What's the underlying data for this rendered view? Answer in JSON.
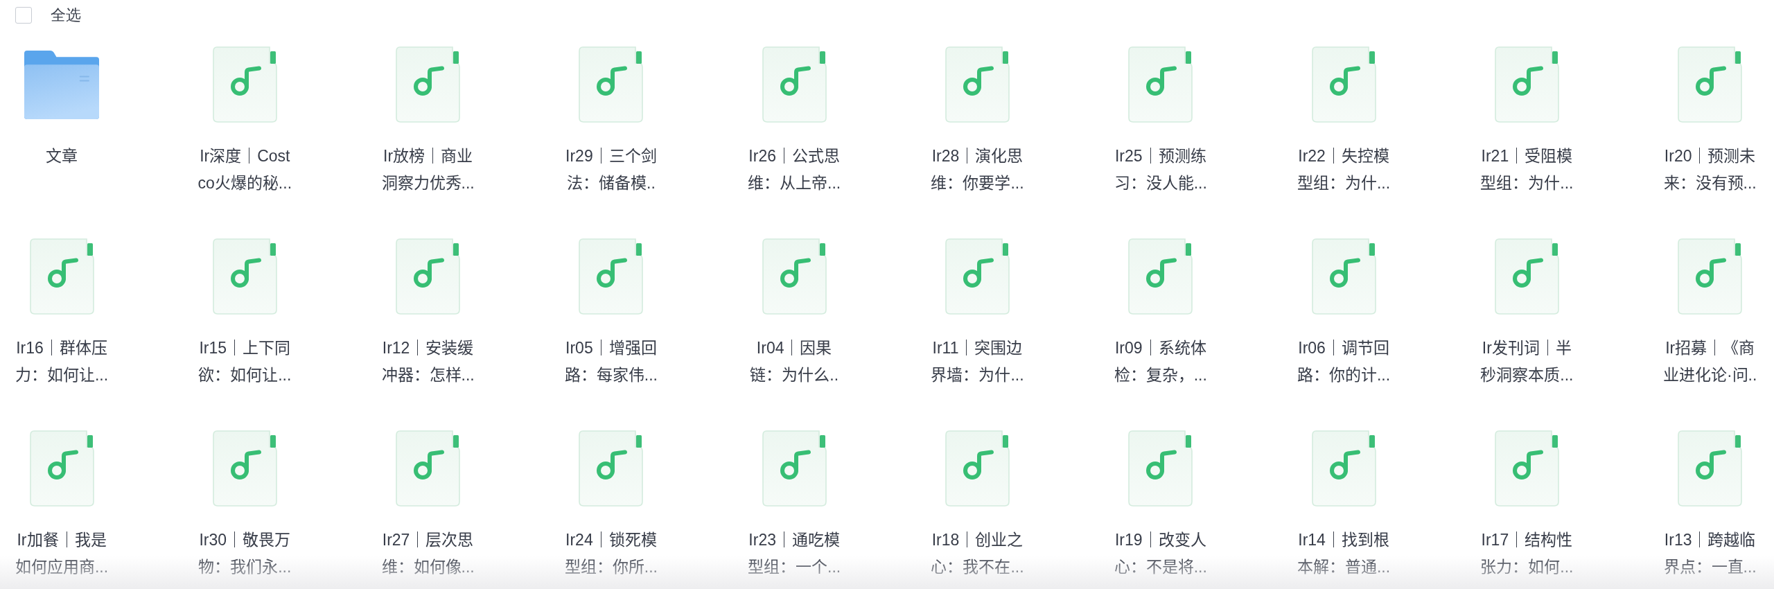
{
  "select_all": {
    "label": "全选",
    "checked": false
  },
  "items": [
    {
      "kind": "folder",
      "name": "文章"
    },
    {
      "kind": "audio",
      "name": "Ir深度｜Costco火爆的秘..."
    },
    {
      "kind": "audio",
      "name": "Ir放榜｜商业洞察力优秀..."
    },
    {
      "kind": "audio",
      "name": "Ir29｜三个剑法：储备模.."
    },
    {
      "kind": "audio",
      "name": "Ir26｜公式思维：从上帝..."
    },
    {
      "kind": "audio",
      "name": "Ir28｜演化思维：你要学..."
    },
    {
      "kind": "audio",
      "name": "Ir25｜预测练习：没人能..."
    },
    {
      "kind": "audio",
      "name": "Ir22｜失控模型组：为什..."
    },
    {
      "kind": "audio",
      "name": "Ir21｜受阻模型组：为什..."
    },
    {
      "kind": "audio",
      "name": "Ir20｜预测未来：没有预..."
    },
    {
      "kind": "audio",
      "name": "Ir16｜群体压力：如何让..."
    },
    {
      "kind": "audio",
      "name": "Ir15｜上下同欲：如何让..."
    },
    {
      "kind": "audio",
      "name": "Ir12｜安装缓冲器：怎样..."
    },
    {
      "kind": "audio",
      "name": "Ir05｜增强回路：每家伟..."
    },
    {
      "kind": "audio",
      "name": "Ir04｜因果链：为什么.."
    },
    {
      "kind": "audio",
      "name": "Ir11｜突围边界墙：为什..."
    },
    {
      "kind": "audio",
      "name": "Ir09｜系统体检：复杂，..."
    },
    {
      "kind": "audio",
      "name": "Ir06｜调节回路：你的计..."
    },
    {
      "kind": "audio",
      "name": "Ir发刊词｜半秒洞察本质..."
    },
    {
      "kind": "audio",
      "name": "Ir招募｜《商业进化论·问.."
    },
    {
      "kind": "audio",
      "name": "Ir加餐｜我是如何应用商..."
    },
    {
      "kind": "audio",
      "name": "Ir30｜敬畏万物：我们永..."
    },
    {
      "kind": "audio",
      "name": "Ir27｜层次思维：如何像..."
    },
    {
      "kind": "audio",
      "name": "Ir24｜锁死模型组：你所..."
    },
    {
      "kind": "audio",
      "name": "Ir23｜通吃模型组：一个..."
    },
    {
      "kind": "audio",
      "name": "Ir18｜创业之心：我不在..."
    },
    {
      "kind": "audio",
      "name": "Ir19｜改变人心：不是将..."
    },
    {
      "kind": "audio",
      "name": "Ir14｜找到根本解：普通..."
    },
    {
      "kind": "audio",
      "name": "Ir17｜结构性张力：如何..."
    },
    {
      "kind": "audio",
      "name": "Ir13｜跨越临界点：一直..."
    }
  ]
}
